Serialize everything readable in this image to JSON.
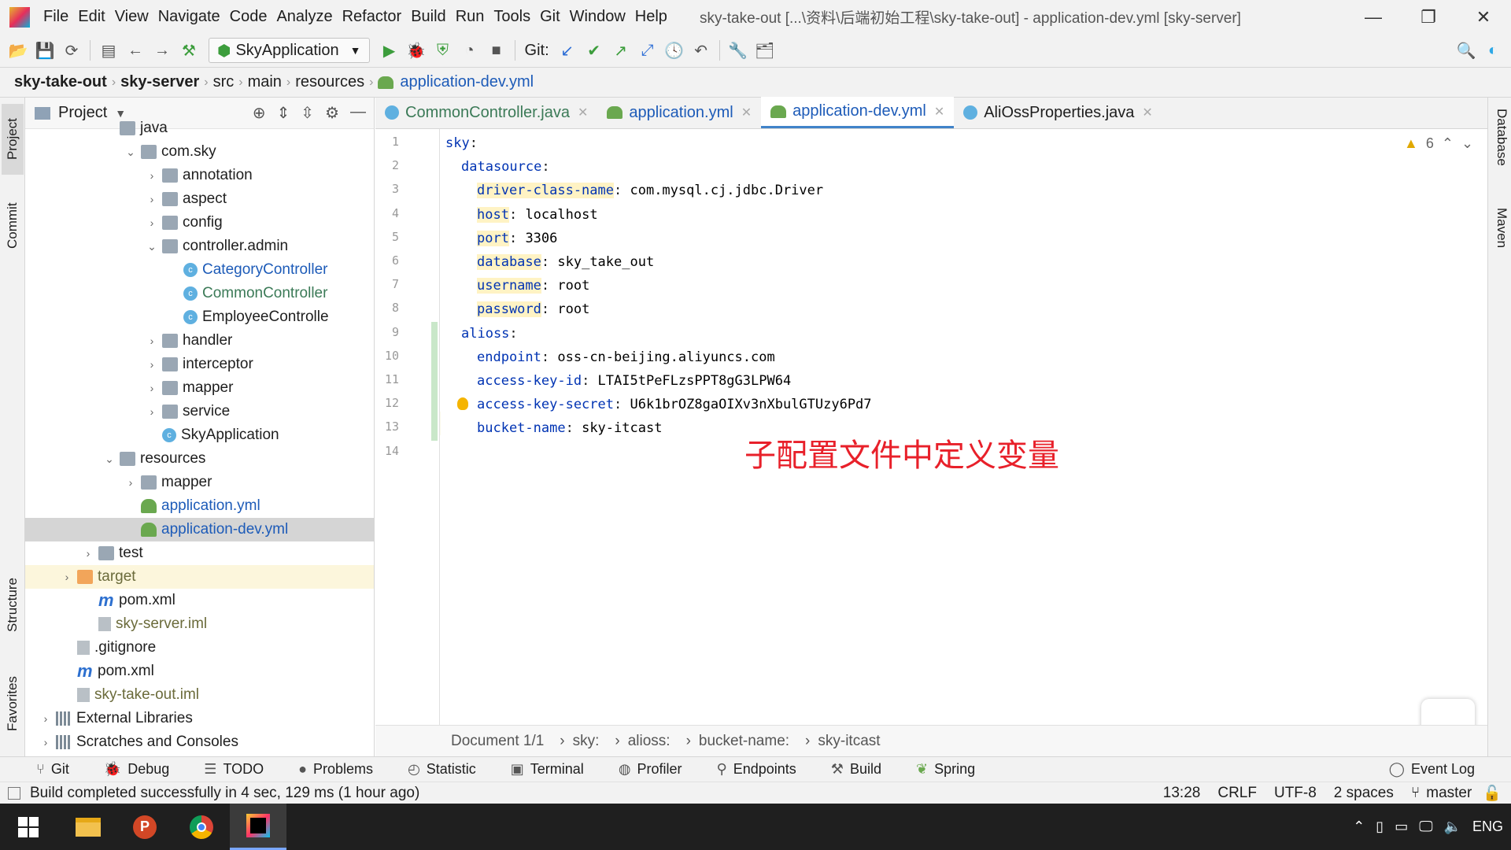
{
  "menubar": {
    "items": [
      "File",
      "Edit",
      "View",
      "Navigate",
      "Code",
      "Analyze",
      "Refactor",
      "Build",
      "Run",
      "Tools",
      "Git",
      "Window",
      "Help"
    ],
    "title": "sky-take-out [...\\资料\\后端初始工程\\sky-take-out] - application-dev.yml [sky-server]",
    "minimize": "—",
    "restore": "❐",
    "close": "✕"
  },
  "toolbar": {
    "run_config": "SkyApplication",
    "git_label": "Git:"
  },
  "breadcrumb": [
    "sky-take-out",
    "sky-server",
    "src",
    "main",
    "resources",
    "application-dev.yml"
  ],
  "left_strip": {
    "project": "Project",
    "commit": "Commit",
    "structure": "Structure",
    "favorites": "Favorites"
  },
  "right_strip": {
    "database": "Database",
    "maven": "Maven"
  },
  "project_panel": {
    "title": "Project",
    "tree": [
      {
        "label": "java",
        "indent": 4,
        "arrow": "",
        "kind": "folder",
        "style": ""
      },
      {
        "label": "com.sky",
        "indent": 5,
        "arrow": "⌄",
        "kind": "folder",
        "style": ""
      },
      {
        "label": "annotation",
        "indent": 6,
        "arrow": "›",
        "kind": "folder",
        "style": ""
      },
      {
        "label": "aspect",
        "indent": 6,
        "arrow": "›",
        "kind": "folder",
        "style": ""
      },
      {
        "label": "config",
        "indent": 6,
        "arrow": "›",
        "kind": "folder",
        "style": ""
      },
      {
        "label": "controller.admin",
        "indent": 6,
        "arrow": "⌄",
        "kind": "folder",
        "style": ""
      },
      {
        "label": "CategoryController",
        "indent": 7,
        "arrow": "",
        "kind": "class",
        "style": "blue"
      },
      {
        "label": "CommonController",
        "indent": 7,
        "arrow": "",
        "kind": "class",
        "style": "grn"
      },
      {
        "label": "EmployeeControlle",
        "indent": 7,
        "arrow": "",
        "kind": "class",
        "style": ""
      },
      {
        "label": "handler",
        "indent": 6,
        "arrow": "›",
        "kind": "folder",
        "style": ""
      },
      {
        "label": "interceptor",
        "indent": 6,
        "arrow": "›",
        "kind": "folder",
        "style": ""
      },
      {
        "label": "mapper",
        "indent": 6,
        "arrow": "›",
        "kind": "folder",
        "style": ""
      },
      {
        "label": "service",
        "indent": 6,
        "arrow": "›",
        "kind": "folder",
        "style": ""
      },
      {
        "label": "SkyApplication",
        "indent": 6,
        "arrow": "",
        "kind": "class",
        "style": ""
      },
      {
        "label": "resources",
        "indent": 4,
        "arrow": "⌄",
        "kind": "folder",
        "style": ""
      },
      {
        "label": "mapper",
        "indent": 5,
        "arrow": "›",
        "kind": "folder",
        "style": ""
      },
      {
        "label": "application.yml",
        "indent": 5,
        "arrow": "",
        "kind": "yml",
        "style": "blue"
      },
      {
        "label": "application-dev.yml",
        "indent": 5,
        "arrow": "",
        "kind": "yml",
        "style": "blue sel"
      },
      {
        "label": "test",
        "indent": 3,
        "arrow": "›",
        "kind": "folder",
        "style": ""
      },
      {
        "label": "target",
        "indent": 2,
        "arrow": "›",
        "kind": "folder-o",
        "style": "olive hl"
      },
      {
        "label": "pom.xml",
        "indent": 3,
        "arrow": "",
        "kind": "maven",
        "style": ""
      },
      {
        "label": "sky-server.iml",
        "indent": 3,
        "arrow": "",
        "kind": "file",
        "style": "olive"
      },
      {
        "label": ".gitignore",
        "indent": 2,
        "arrow": "",
        "kind": "file",
        "style": ""
      },
      {
        "label": "pom.xml",
        "indent": 2,
        "arrow": "",
        "kind": "maven",
        "style": ""
      },
      {
        "label": "sky-take-out.iml",
        "indent": 2,
        "arrow": "",
        "kind": "file",
        "style": "olive"
      },
      {
        "label": "External Libraries",
        "indent": 1,
        "arrow": "›",
        "kind": "lib",
        "style": ""
      },
      {
        "label": "Scratches and Consoles",
        "indent": 1,
        "arrow": "›",
        "kind": "lib",
        "style": ""
      }
    ]
  },
  "editor_tabs": [
    {
      "label": "CommonController.java",
      "icon": "c",
      "active": false,
      "style": "grn"
    },
    {
      "label": "application.yml",
      "icon": "y",
      "active": false,
      "style": "blue"
    },
    {
      "label": "application-dev.yml",
      "icon": "y",
      "active": true,
      "style": "blue"
    },
    {
      "label": "AliOssProperties.java",
      "icon": "c",
      "active": false,
      "style": ""
    }
  ],
  "code": [
    {
      "n": "1",
      "indent": 0,
      "key": "sky",
      "value": ""
    },
    {
      "n": "2",
      "indent": 1,
      "key": "datasource",
      "value": ""
    },
    {
      "n": "3",
      "indent": 2,
      "key": "driver-class-name",
      "value": " com.mysql.cj.jdbc.Driver",
      "hl": true
    },
    {
      "n": "4",
      "indent": 2,
      "key": "host",
      "value": " localhost",
      "hl": true
    },
    {
      "n": "5",
      "indent": 2,
      "key": "port",
      "value": " 3306",
      "hl": true
    },
    {
      "n": "6",
      "indent": 2,
      "key": "database",
      "value": " sky_take_out",
      "hl": true
    },
    {
      "n": "7",
      "indent": 2,
      "key": "username",
      "value": " root",
      "hl": true
    },
    {
      "n": "8",
      "indent": 2,
      "key": "password",
      "value": " root",
      "hl": true
    },
    {
      "n": "9",
      "indent": 1,
      "key": "alioss",
      "value": ""
    },
    {
      "n": "10",
      "indent": 2,
      "key": "endpoint",
      "value": " oss-cn-beijing.aliyuncs.com"
    },
    {
      "n": "11",
      "indent": 2,
      "key": "access-key-id",
      "value": " LTAI5tPeFLzsPPT8gG3LPW64"
    },
    {
      "n": "12",
      "indent": 2,
      "key": "access-key-secret",
      "value": " U6k1brOZ8gaOIXv3nXbulGTUzy6Pd7"
    },
    {
      "n": "13",
      "indent": 2,
      "key": "bucket-name",
      "value": " sky-itcast"
    },
    {
      "n": "14",
      "indent": 0,
      "key": "",
      "value": ""
    }
  ],
  "warnings": "6",
  "annotation": "子配置文件中定义变量",
  "status_path": [
    "Document 1/1",
    "sky:",
    "alioss:",
    "bucket-name:",
    "sky-itcast"
  ],
  "bottom_tools": [
    "Git",
    "Debug",
    "TODO",
    "Problems",
    "Statistic",
    "Terminal",
    "Profiler",
    "Endpoints",
    "Build",
    "Spring"
  ],
  "event_log": "Event Log",
  "status": {
    "message": "Build completed successfully in 4 sec, 129 ms (1 hour ago)",
    "pos": "13:28",
    "eol": "CRLF",
    "enc": "UTF-8",
    "indent": "2 spaces",
    "branch": "master"
  },
  "taskbar": {
    "lang": "ENG"
  }
}
